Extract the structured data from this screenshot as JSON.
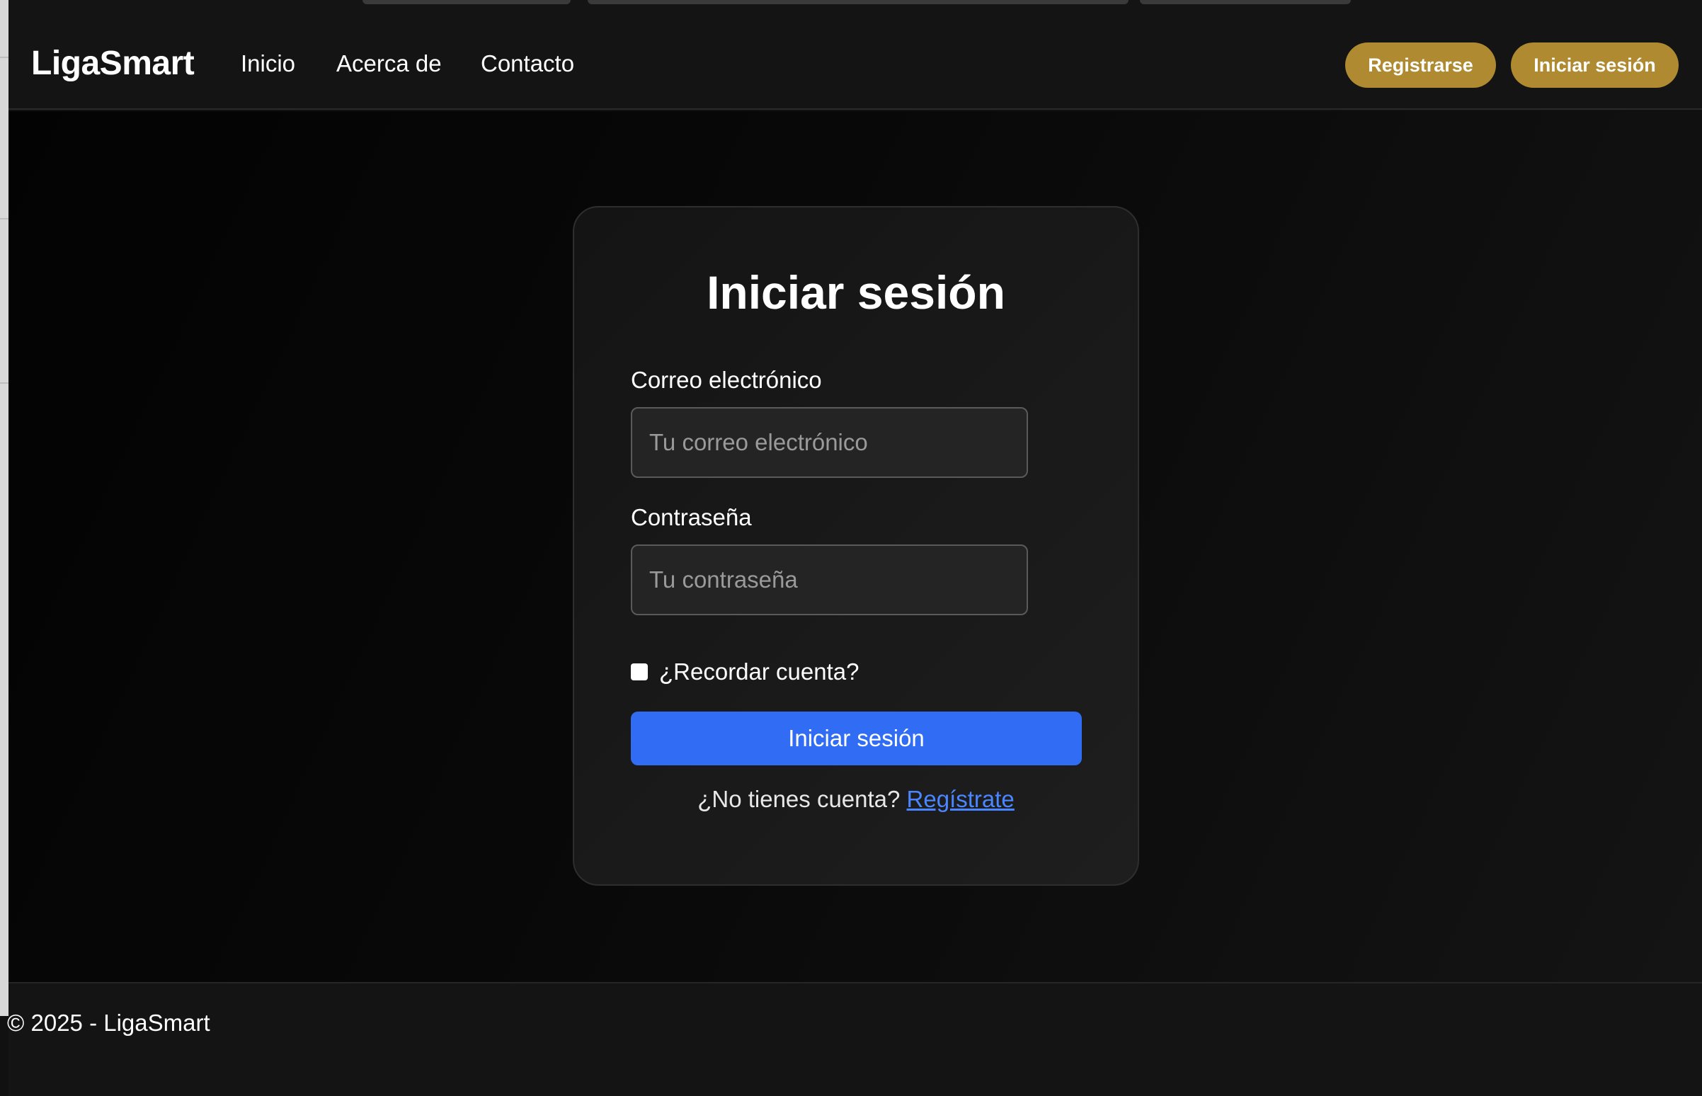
{
  "navbar": {
    "brand": "LigaSmart",
    "links": [
      "Inicio",
      "Acerca de",
      "Contacto"
    ],
    "register_button": "Registrarse",
    "login_button": "Iniciar sesión"
  },
  "login_card": {
    "title": "Iniciar sesión",
    "email": {
      "label": "Correo electrónico",
      "placeholder": "Tu correo electrónico",
      "value": ""
    },
    "password": {
      "label": "Contraseña",
      "placeholder": "Tu contraseña",
      "value": ""
    },
    "remember_label": "¿Recordar cuenta?",
    "remember_checked": false,
    "submit_label": "Iniciar sesión",
    "no_account_text": "¿No tienes cuenta?",
    "signup_link": "Regístrate"
  },
  "footer": {
    "text": "© 2025 - LigaSmart"
  },
  "colors": {
    "accent_gold": "#b08a30",
    "primary_blue": "#316cf4",
    "link_blue": "#4a86ff",
    "background": "#111111"
  }
}
